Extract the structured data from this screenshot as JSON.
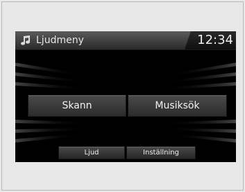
{
  "header": {
    "icon": "music-note-icon",
    "title": "Ljudmeny",
    "clock": "12:34"
  },
  "main": {
    "buttons": [
      {
        "label": "Skann"
      },
      {
        "label": "Musiksök"
      }
    ]
  },
  "footer": {
    "tabs": [
      {
        "label": "Ljud"
      },
      {
        "label": "Inställning"
      }
    ]
  },
  "colors": {
    "screen_bg": "#000000",
    "bar_bg": "#3a3a3a",
    "text": "#f0f0f0",
    "frame_bg": "#e8e8e8"
  }
}
